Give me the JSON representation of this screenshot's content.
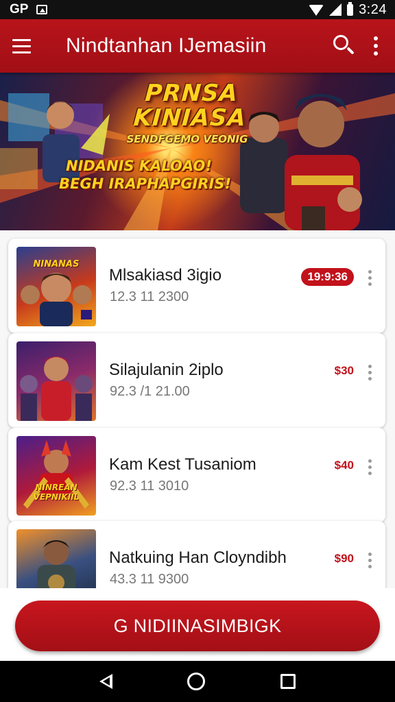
{
  "status_bar": {
    "carrier": "GP",
    "time": "3:24",
    "icons": [
      "image-icon",
      "wifi-icon",
      "signal-icon",
      "battery-icon"
    ]
  },
  "app_bar": {
    "title": "Nindtanhan IJemasiin",
    "icons": [
      "menu-icon",
      "search-icon",
      "overflow-menu-icon"
    ]
  },
  "banner": {
    "title": "PRNSA KINIASA",
    "subtitle": "SENDFGEMO VEONIG",
    "tag_line1": "NIDANIS KALOAO!",
    "tag_line2": "BEGH IRAPHAPGIRIS!"
  },
  "games": [
    {
      "name": "Mlsakiasd 3igio",
      "meta": "12.3 11 2300",
      "price": "19:9:36",
      "badge_style": "pill",
      "thumb_caption": "NINANAS"
    },
    {
      "name": "Silajulanin 2iplo",
      "meta": "92.3 /1 21.00",
      "price": "$30",
      "badge_style": "text",
      "thumb_caption": ""
    },
    {
      "name": "Kam Kest Tusaniom",
      "meta": "92.3 11 3010",
      "price": "$40",
      "badge_style": "text",
      "thumb_caption": "NINREAN VEPNIKIIL"
    },
    {
      "name": "Natkuing Han Cloyndibh",
      "meta": "43.3 11 9300",
      "price": "$90",
      "badge_style": "text",
      "thumb_caption": ""
    }
  ],
  "cta": {
    "label": "G NIDIINASIMBIGK"
  },
  "nav_bar": {
    "icons": [
      "back-icon",
      "home-icon",
      "recents-icon"
    ]
  },
  "colors": {
    "primary": "#b8141b",
    "accent_text": "#c2121b",
    "banner_text": "#ffd21f"
  }
}
